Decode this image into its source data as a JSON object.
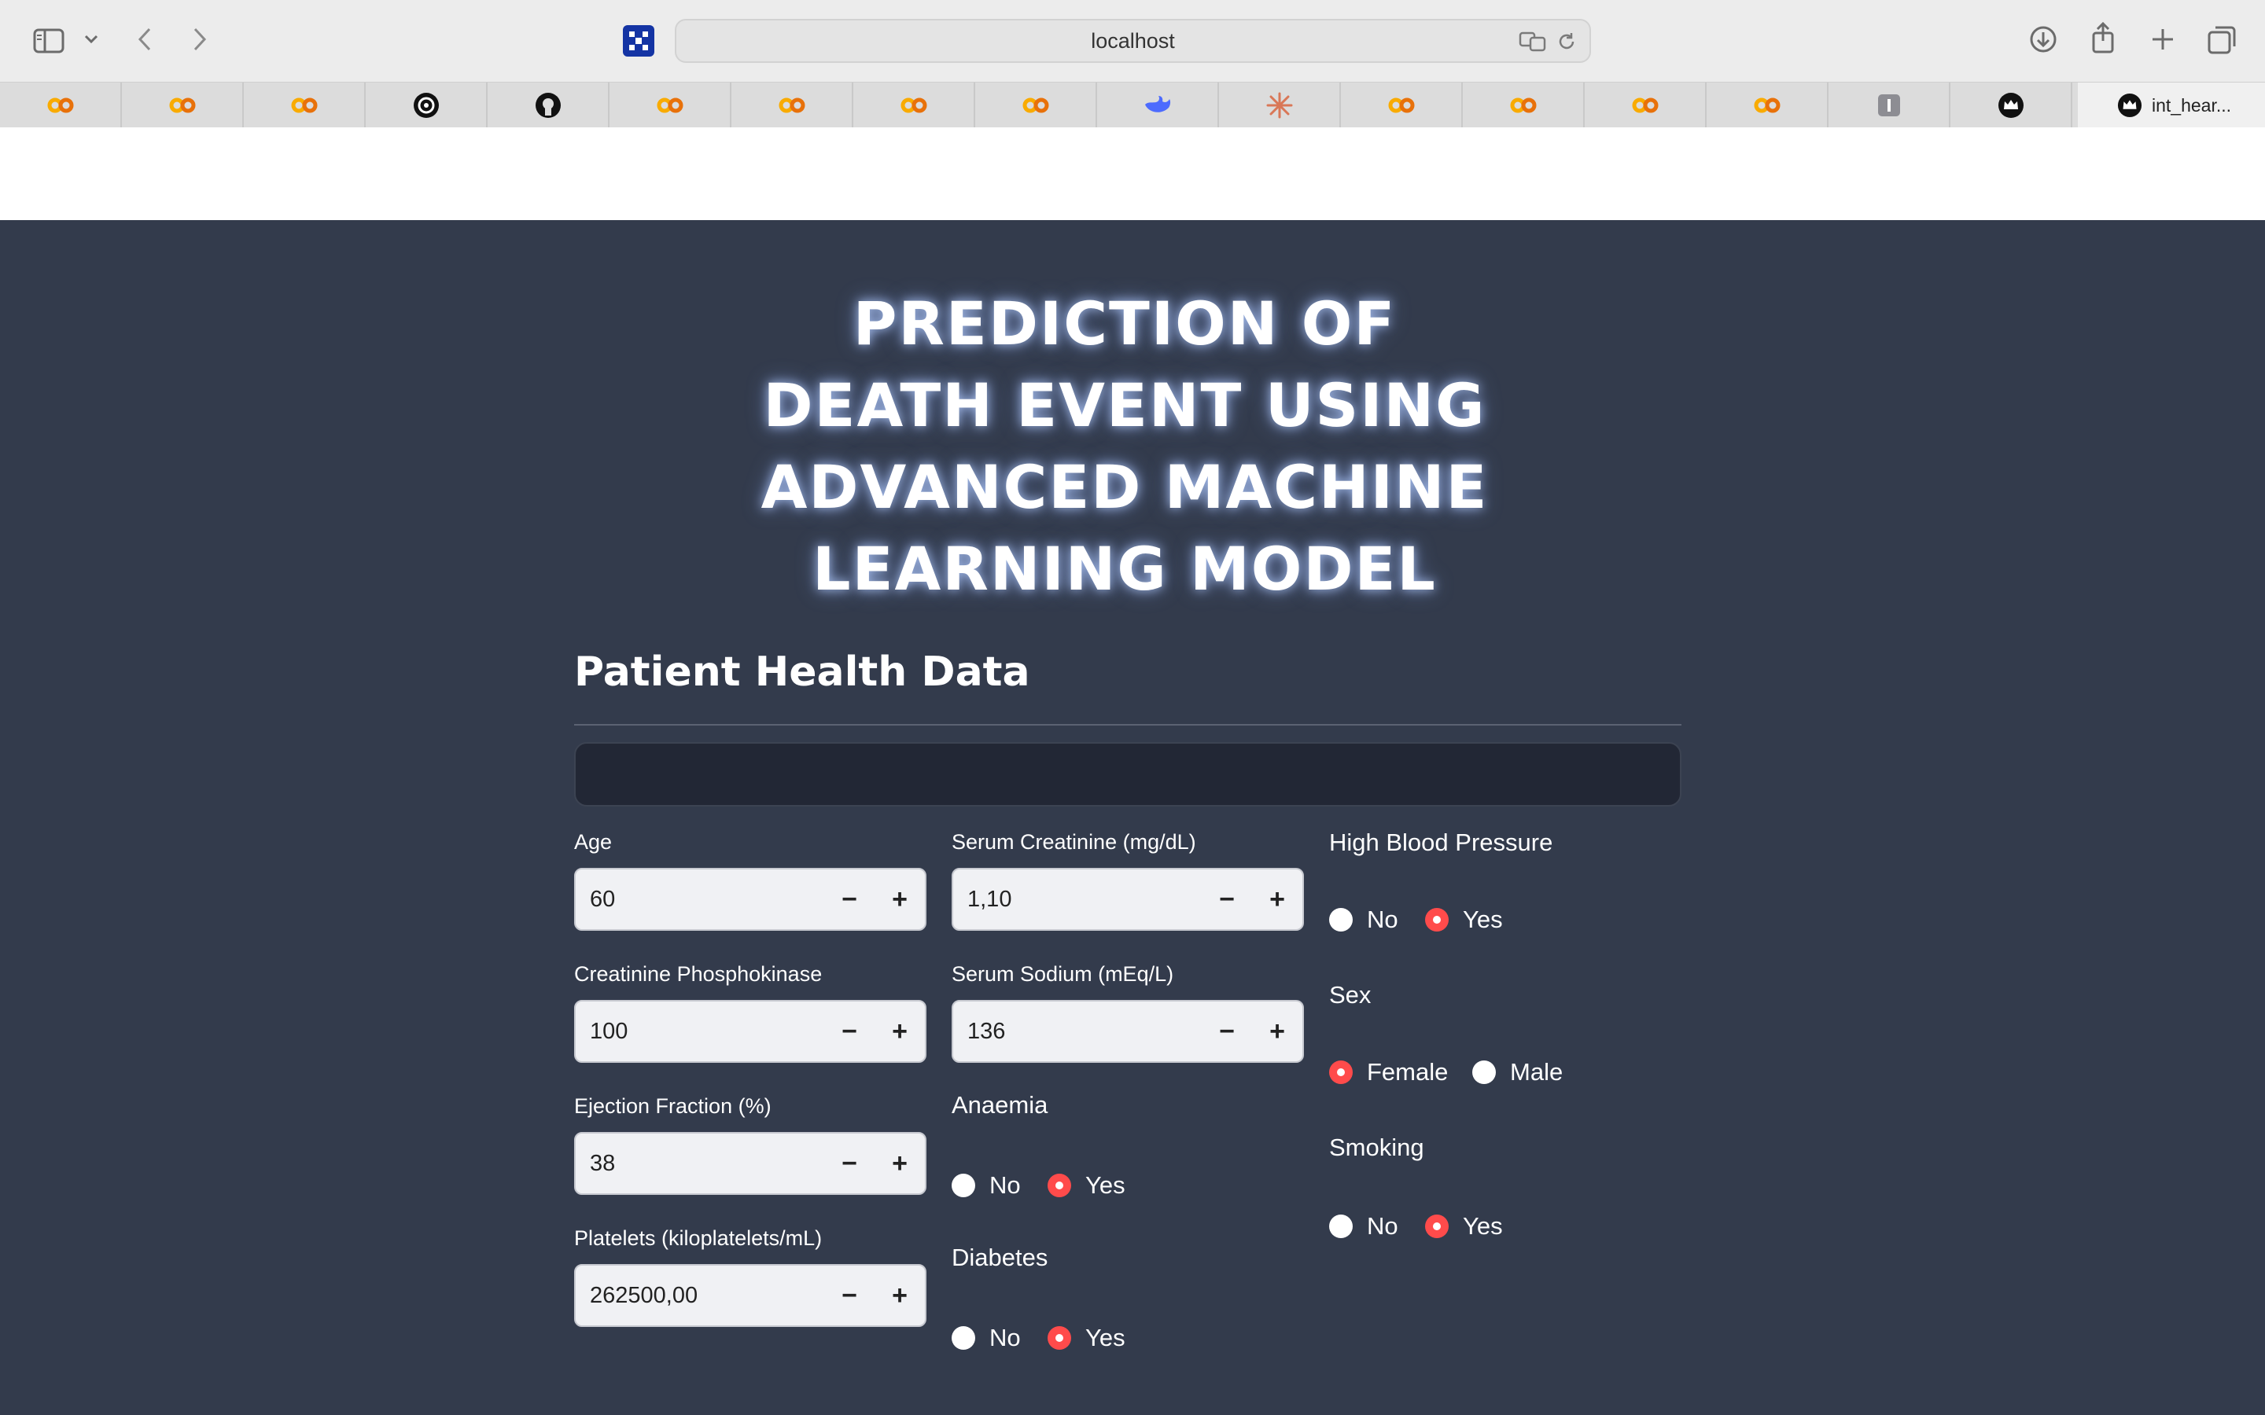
{
  "browser": {
    "url": "localhost",
    "active_tab": "int_hear...",
    "tab_icons": [
      "colab-icon",
      "colab-icon",
      "colab-icon",
      "openai-icon",
      "github-icon",
      "colab-icon",
      "colab-icon",
      "colab-icon",
      "colab-icon",
      "deepseek-icon",
      "claude-icon",
      "colab-icon",
      "colab-icon",
      "colab-icon",
      "colab-icon",
      "gray-i-icon",
      "crown-icon"
    ]
  },
  "app": {
    "title_lines": [
      "PREDICTION OF",
      "DEATH EVENT USING",
      "ADVANCED MACHINE",
      "LEARNING MODEL"
    ],
    "section_title": "Patient Health Data",
    "inputs": {
      "age": {
        "label": "Age",
        "value": "60"
      },
      "cpk": {
        "label": "Creatinine Phosphokinase",
        "value": "100"
      },
      "ef": {
        "label": "Ejection Fraction (%)",
        "value": "38"
      },
      "platelets": {
        "label": "Platelets (kiloplatelets/mL)",
        "value": "262500,00"
      },
      "creatinine": {
        "label": "Serum Creatinine (mg/dL)",
        "value": "1,10"
      },
      "sodium": {
        "label": "Serum Sodium (mEq/L)",
        "value": "136"
      }
    },
    "stepper": {
      "minus": "−",
      "plus": "+"
    },
    "radios": {
      "anaemia": {
        "label": "Anaemia",
        "options": [
          "No",
          "Yes"
        ],
        "selected": "Yes"
      },
      "diabetes": {
        "label": "Diabetes",
        "options": [
          "No",
          "Yes"
        ],
        "selected": "Yes"
      },
      "hbp": {
        "label": "High Blood Pressure",
        "options": [
          "No",
          "Yes"
        ],
        "selected": "Yes"
      },
      "sex": {
        "label": "Sex",
        "options": [
          "Female",
          "Male"
        ],
        "selected": "Female"
      },
      "smoking": {
        "label": "Smoking",
        "options": [
          "No",
          "Yes"
        ],
        "selected": "Yes"
      }
    },
    "colors": {
      "background": "#333b4c",
      "accent": "#ff4b4b",
      "input_bg": "#f0f1f4"
    }
  }
}
